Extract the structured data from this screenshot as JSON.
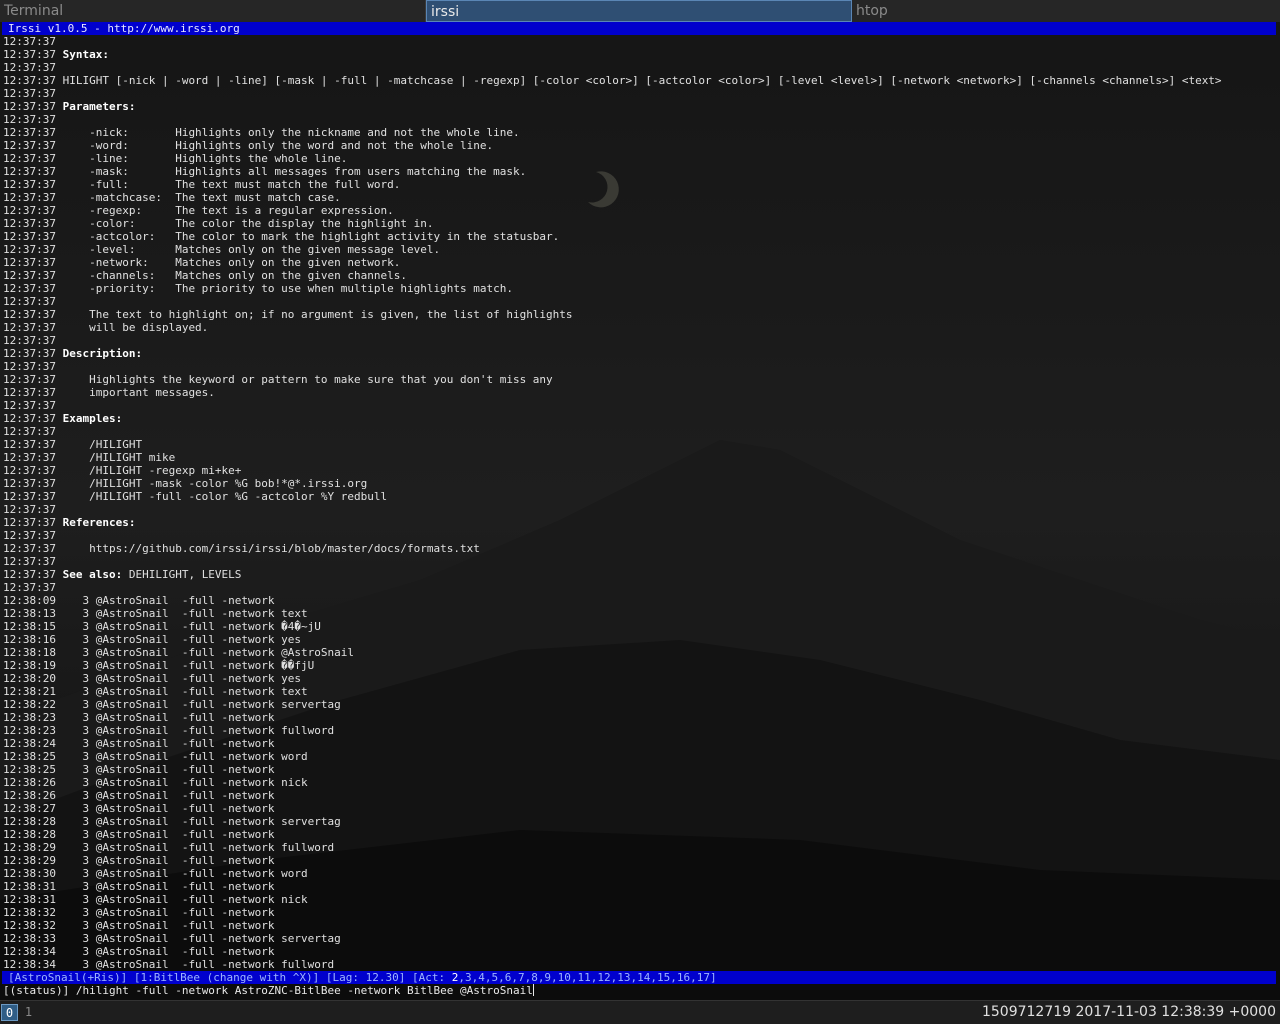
{
  "tabs": [
    {
      "label": "Terminal",
      "active": false
    },
    {
      "label": "irssi",
      "active": true
    },
    {
      "label": "htop",
      "active": false
    }
  ],
  "title": "Irssi v1.0.5 - http://www.irssi.org",
  "lines": [
    {
      "ts": "12:37:37",
      "text": ""
    },
    {
      "ts": "12:37:37",
      "text": "Syntax:",
      "bold": true
    },
    {
      "ts": "12:37:37",
      "text": ""
    },
    {
      "ts": "12:37:37",
      "text": "HILIGHT [-nick | -word | -line] [-mask | -full | -matchcase | -regexp] [-color <color>] [-actcolor <color>] [-level <level>] [-network <network>] [-channels <channels>] <text>"
    },
    {
      "ts": "12:37:37",
      "text": ""
    },
    {
      "ts": "12:37:37",
      "text": "Parameters:",
      "bold": true
    },
    {
      "ts": "12:37:37",
      "text": ""
    },
    {
      "ts": "12:37:37",
      "text": "    -nick:       Highlights only the nickname and not the whole line."
    },
    {
      "ts": "12:37:37",
      "text": "    -word:       Highlights only the word and not the whole line."
    },
    {
      "ts": "12:37:37",
      "text": "    -line:       Highlights the whole line."
    },
    {
      "ts": "12:37:37",
      "text": "    -mask:       Highlights all messages from users matching the mask."
    },
    {
      "ts": "12:37:37",
      "text": "    -full:       The text must match the full word."
    },
    {
      "ts": "12:37:37",
      "text": "    -matchcase:  The text must match case."
    },
    {
      "ts": "12:37:37",
      "text": "    -regexp:     The text is a regular expression."
    },
    {
      "ts": "12:37:37",
      "text": "    -color:      The color the display the highlight in."
    },
    {
      "ts": "12:37:37",
      "text": "    -actcolor:   The color to mark the highlight activity in the statusbar."
    },
    {
      "ts": "12:37:37",
      "text": "    -level:      Matches only on the given message level."
    },
    {
      "ts": "12:37:37",
      "text": "    -network:    Matches only on the given network."
    },
    {
      "ts": "12:37:37",
      "text": "    -channels:   Matches only on the given channels."
    },
    {
      "ts": "12:37:37",
      "text": "    -priority:   The priority to use when multiple highlights match."
    },
    {
      "ts": "12:37:37",
      "text": ""
    },
    {
      "ts": "12:37:37",
      "text": "    The text to highlight on; if no argument is given, the list of highlights"
    },
    {
      "ts": "12:37:37",
      "text": "    will be displayed."
    },
    {
      "ts": "12:37:37",
      "text": ""
    },
    {
      "ts": "12:37:37",
      "text": "Description:",
      "bold": true
    },
    {
      "ts": "12:37:37",
      "text": ""
    },
    {
      "ts": "12:37:37",
      "text": "    Highlights the keyword or pattern to make sure that you don't miss any"
    },
    {
      "ts": "12:37:37",
      "text": "    important messages."
    },
    {
      "ts": "12:37:37",
      "text": ""
    },
    {
      "ts": "12:37:37",
      "text": "Examples:",
      "bold": true
    },
    {
      "ts": "12:37:37",
      "text": ""
    },
    {
      "ts": "12:37:37",
      "text": "    /HILIGHT"
    },
    {
      "ts": "12:37:37",
      "text": "    /HILIGHT mike"
    },
    {
      "ts": "12:37:37",
      "text": "    /HILIGHT -regexp mi+ke+"
    },
    {
      "ts": "12:37:37",
      "text": "    /HILIGHT -mask -color %G bob!*@*.irssi.org"
    },
    {
      "ts": "12:37:37",
      "text": "    /HILIGHT -full -color %G -actcolor %Y redbull"
    },
    {
      "ts": "12:37:37",
      "text": ""
    },
    {
      "ts": "12:37:37",
      "text": "References:",
      "bold": true
    },
    {
      "ts": "12:37:37",
      "text": ""
    },
    {
      "ts": "12:37:37",
      "text": "    https://github.com/irssi/irssi/blob/master/docs/formats.txt"
    },
    {
      "ts": "12:37:37",
      "text": ""
    },
    {
      "ts": "12:37:37",
      "bold_prefix": "See also:",
      "text": " DEHILIGHT, LEVELS"
    },
    {
      "ts": "12:37:37",
      "text": ""
    },
    {
      "ts": "12:38:09",
      "text": "   3 @AstroSnail  -full -network"
    },
    {
      "ts": "12:38:13",
      "text": "   3 @AstroSnail  -full -network text"
    },
    {
      "ts": "12:38:15",
      "text": "   3 @AstroSnail  -full -network �4�~jU"
    },
    {
      "ts": "12:38:16",
      "text": "   3 @AstroSnail  -full -network yes"
    },
    {
      "ts": "12:38:18",
      "text": "   3 @AstroSnail  -full -network @AstroSnail"
    },
    {
      "ts": "12:38:19",
      "text": "   3 @AstroSnail  -full -network ��fjU"
    },
    {
      "ts": "12:38:20",
      "text": "   3 @AstroSnail  -full -network yes"
    },
    {
      "ts": "12:38:21",
      "text": "   3 @AstroSnail  -full -network text"
    },
    {
      "ts": "12:38:22",
      "text": "   3 @AstroSnail  -full -network servertag"
    },
    {
      "ts": "12:38:23",
      "text": "   3 @AstroSnail  -full -network"
    },
    {
      "ts": "12:38:23",
      "text": "   3 @AstroSnail  -full -network fullword"
    },
    {
      "ts": "12:38:24",
      "text": "   3 @AstroSnail  -full -network"
    },
    {
      "ts": "12:38:25",
      "text": "   3 @AstroSnail  -full -network word"
    },
    {
      "ts": "12:38:25",
      "text": "   3 @AstroSnail  -full -network"
    },
    {
      "ts": "12:38:26",
      "text": "   3 @AstroSnail  -full -network nick"
    },
    {
      "ts": "12:38:26",
      "text": "   3 @AstroSnail  -full -network"
    },
    {
      "ts": "12:38:27",
      "text": "   3 @AstroSnail  -full -network"
    },
    {
      "ts": "12:38:28",
      "text": "   3 @AstroSnail  -full -network servertag"
    },
    {
      "ts": "12:38:28",
      "text": "   3 @AstroSnail  -full -network"
    },
    {
      "ts": "12:38:29",
      "text": "   3 @AstroSnail  -full -network fullword"
    },
    {
      "ts": "12:38:29",
      "text": "   3 @AstroSnail  -full -network"
    },
    {
      "ts": "12:38:30",
      "text": "   3 @AstroSnail  -full -network word"
    },
    {
      "ts": "12:38:31",
      "text": "   3 @AstroSnail  -full -network"
    },
    {
      "ts": "12:38:31",
      "text": "   3 @AstroSnail  -full -network nick"
    },
    {
      "ts": "12:38:32",
      "text": "   3 @AstroSnail  -full -network"
    },
    {
      "ts": "12:38:32",
      "text": "   3 @AstroSnail  -full -network"
    },
    {
      "ts": "12:38:33",
      "text": "   3 @AstroSnail  -full -network servertag"
    },
    {
      "ts": "12:38:34",
      "text": "   3 @AstroSnail  -full -network"
    },
    {
      "ts": "12:38:34",
      "text": "   3 @AstroSnail  -full -network fullword"
    }
  ],
  "statusbar": {
    "before": "[AstroSnail(+Ris)] [1:BitlBee (change with ^X)] [Lag: 12.30] [Act: ",
    "act_current": "2",
    "after": ",3,4,5,6,7,8,9,10,11,12,13,14,15,16,17]"
  },
  "input": {
    "prompt": "[(status)] ",
    "value": "/hilight -full -network AstroZNC-BitlBee -network BitlBee @AstroSnail"
  },
  "bottombar": {
    "workspaces": [
      "0",
      "1"
    ],
    "clock": "1509712719 2017-11-03 12:38:39 +0000"
  }
}
